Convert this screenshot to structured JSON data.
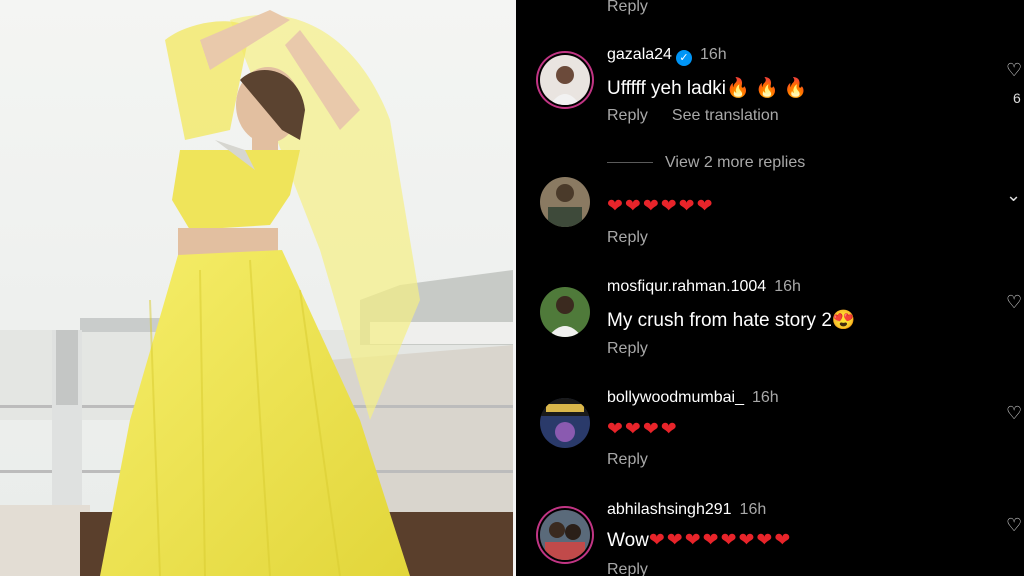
{
  "photo": {
    "description_icon": "woman-in-yellow-lehenga-photo",
    "colors": {
      "outfit": "#f2e84a",
      "sky": "#f3f4f2",
      "sand": "#d8d4cc"
    }
  },
  "comments": [
    {
      "id": "top",
      "reply_label": "Reply"
    },
    {
      "id": "gazala",
      "username": "gazala24",
      "verified": true,
      "time": "16h",
      "text": "Ufffff yeh ladki",
      "emoji": "🔥 🔥 🔥",
      "reply_label": "Reply",
      "translation_label": "See translation",
      "like_count": "6"
    },
    {
      "id": "hearts",
      "hearts": "❤❤❤❤❤❤",
      "reply_label": "Reply"
    },
    {
      "id": "mosfiqur",
      "username": "mosfiqur.rahman.1004",
      "time": "16h",
      "text": "My crush from hate story 2",
      "emoji": "😍",
      "reply_label": "Reply"
    },
    {
      "id": "bollywood",
      "username": "bollywoodmumbai_",
      "time": "16h",
      "hearts": "❤❤❤❤",
      "reply_label": "Reply"
    },
    {
      "id": "abhilash",
      "username": "abhilashsingh291",
      "time": "16h",
      "text": "Wow",
      "hearts": "❤❤❤❤❤❤❤❤",
      "reply_label": "Reply"
    }
  ],
  "view_more_replies": "View 2 more replies",
  "colors": {
    "background": "#000000",
    "muted": "#a8a8a8",
    "verified": "#0095f6",
    "heart": "#e8242a"
  }
}
